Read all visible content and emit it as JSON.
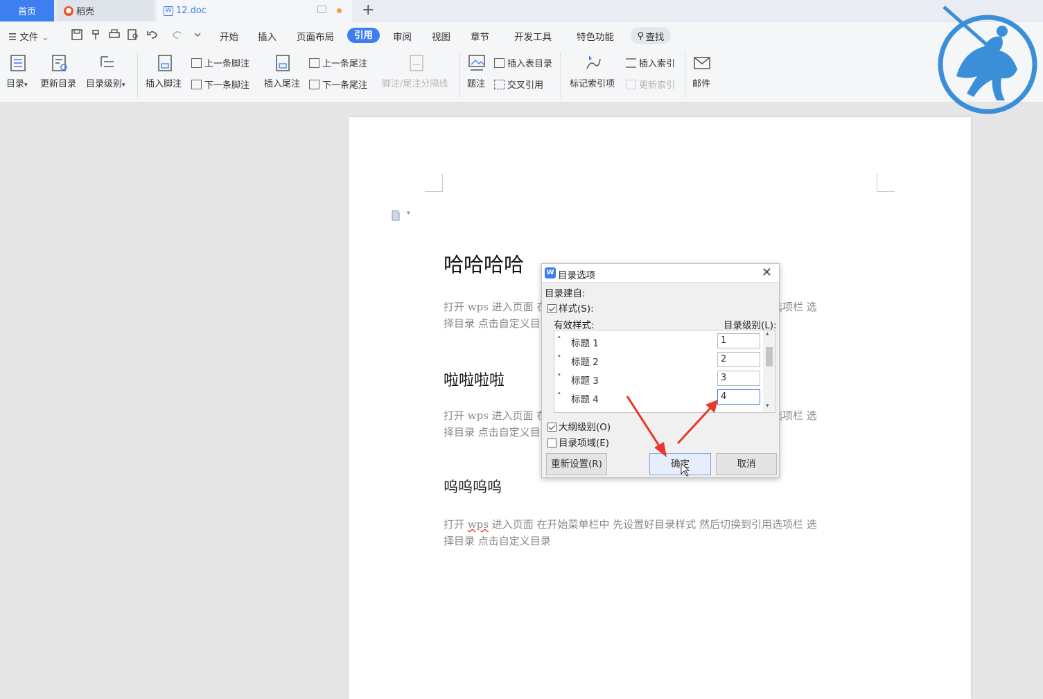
{
  "tabs": {
    "home": "首页",
    "daoke": "稻壳",
    "doc": "12.doc",
    "new_tab": "+"
  },
  "menu": {
    "file": "文件",
    "items": [
      "开始",
      "插入",
      "页面布局",
      "引用",
      "审阅",
      "视图",
      "章节",
      "开发工具",
      "特色功能"
    ],
    "active": "引用",
    "find": "查找"
  },
  "ribbon": {
    "toc": "目录",
    "update_toc": "更新目录",
    "toc_level": "目录级别",
    "insert_footnote": "插入脚注",
    "prev_footnote": "上一条脚注",
    "next_footnote": "下一条脚注",
    "insert_endnote": "插入尾注",
    "prev_endnote": "上一条尾注",
    "next_endnote": "下一条尾注",
    "separator": "脚注/尾注分隔线",
    "caption": "题注",
    "insert_table_of_figures": "插入表目录",
    "cross_ref": "交叉引用",
    "mark_index": "标记索引项",
    "insert_index": "插入索引",
    "update_index": "更新索引",
    "mail": "邮件"
  },
  "document": {
    "h1": "哈哈哈哈",
    "h2": "啦啦啦啦",
    "h3": "呜呜呜呜",
    "p1_line1": "打开 wps    进入页面    在开始菜单栏中    先设置好目录样式    然后切换到引用选项栏    选",
    "p1_line2": "择目录    点击自定义目录",
    "p2_line1": "打开 wps    进入页面    在开始菜单栏中    先设置好目录样式    然后切换到引用选项栏    选",
    "p2_line2": "择目录    点击自定义目录",
    "p3_pre": "打开 ",
    "p3_wps": "wps",
    "p3_line1": "    进入页面    在开始菜单栏中    先设置好目录样式    然后切换到引用选项栏    选",
    "p3_line2": "择目录    点击自定义目录"
  },
  "dialog": {
    "title": "目录选项",
    "build_from": "目录建自:",
    "styles_label": "样式(S):",
    "styles_checked": true,
    "available_styles": "有效样式:",
    "toc_level_header": "目录级别(L):",
    "rows": [
      {
        "name": "标题 1",
        "level": "1"
      },
      {
        "name": "标题 2",
        "level": "2"
      },
      {
        "name": "标题 3",
        "level": "3"
      },
      {
        "name": "标题 4",
        "level": "4"
      }
    ],
    "outline_level": "大纲级别(O)",
    "outline_checked": true,
    "toc_fields": "目录项域(E)",
    "fields_checked": false,
    "reset": "重新设置(R)",
    "ok": "确定",
    "cancel": "取消"
  },
  "colors": {
    "accent": "#3d7ef0",
    "arrow": "#e8382d",
    "logo": "#3a8fd8"
  }
}
